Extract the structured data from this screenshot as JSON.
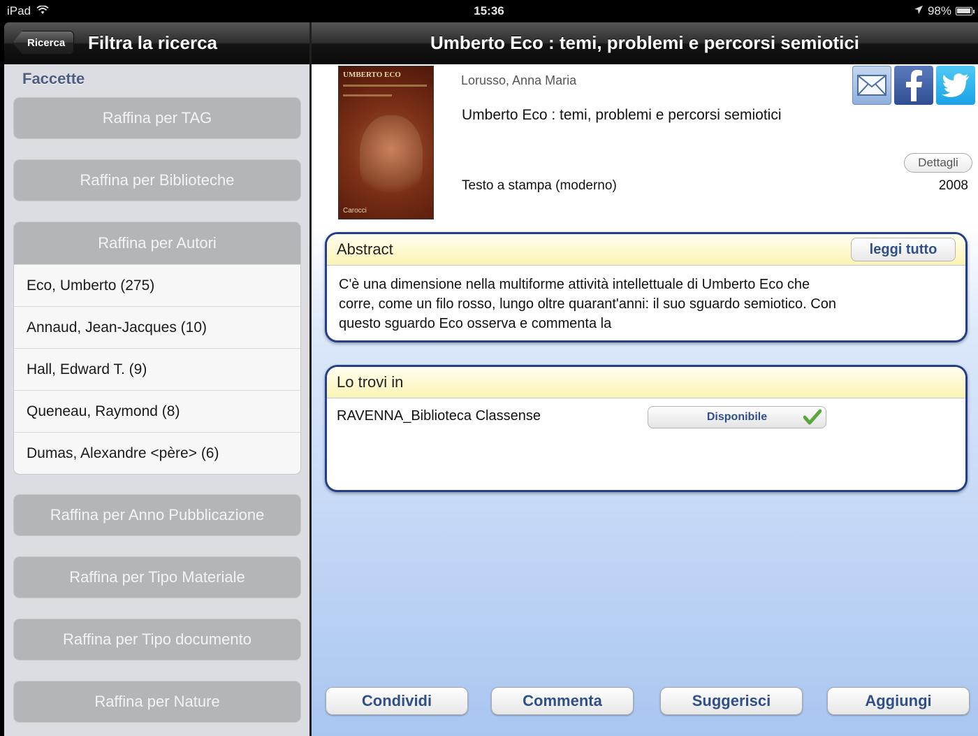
{
  "status_bar": {
    "device": "iPad",
    "time": "15:36",
    "battery": "98%"
  },
  "left": {
    "back_label": "Ricerca",
    "title": "Filtra la ricerca",
    "section_label": "Faccette",
    "facets": [
      "Raffina per TAG",
      "Raffina per Biblioteche",
      "Raffina per Autori",
      "Raffina per Anno Pubblicazione",
      "Raffina per Tipo Materiale",
      "Raffina per Tipo documento",
      "Raffina per Nature"
    ],
    "authors": [
      "Eco, Umberto (275)",
      "Annaud, Jean-Jacques (10)",
      "Hall, Edward T. (9)",
      "Queneau, Raymond (8)",
      "Dumas, Alexandre <père> (6)"
    ]
  },
  "right": {
    "title": "Umberto Eco : temi, problemi e percorsi semiotici",
    "cover": {
      "title": "UMBERTO ECO",
      "publisher": "Carocci"
    },
    "record": {
      "author": "Lorusso, Anna Maria",
      "title": "Umberto Eco : temi, problemi e percorsi semiotici",
      "type": "Testo a stampa (moderno)",
      "year": "2008",
      "details_label": "Dettagli"
    },
    "abstract": {
      "header": "Abstract",
      "read_all_label": "leggi tutto",
      "text": "C'è una dimensione nella multiforme attività intellettuale di Umberto Eco che corre, come un filo rosso, lungo oltre quarant'anni: il suo sguardo semiotico. Con questo sguardo Eco osserva e commenta la"
    },
    "location": {
      "header": "Lo trovi in",
      "library": "RAVENNA_Biblioteca Classense",
      "status": "Disponibile"
    },
    "actions": [
      "Condividi",
      "Commenta",
      "Suggerisci",
      "Aggiungi"
    ]
  },
  "icons": {
    "wifi": "wifi-icon",
    "location": "location-arrow-icon",
    "battery": "battery-icon",
    "mail": "mail-icon",
    "facebook": "facebook-icon",
    "twitter": "twitter-icon",
    "check": "check-icon"
  },
  "colors": {
    "accent": "#30508a",
    "box_border": "#243f8a",
    "facet_button": "#b4b5b9",
    "panel_bg": "#dcdde2",
    "facebook": "#3b5998",
    "twitter": "#1da1f2",
    "check": "#5aa83c"
  }
}
